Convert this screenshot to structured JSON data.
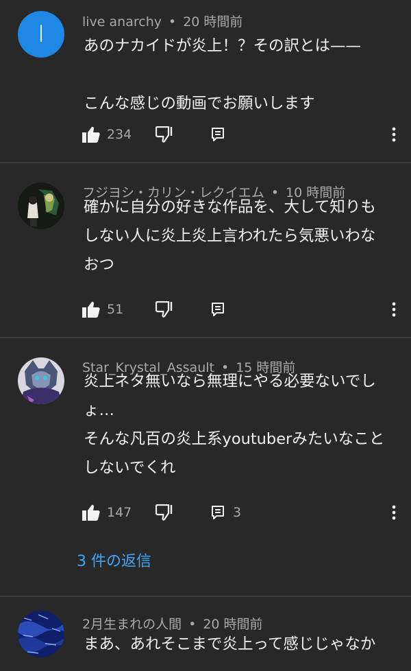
{
  "comments": [
    {
      "author": "live anarchy",
      "time": "20 時間前",
      "avatar_letter": "I",
      "text": "あのナカイドが炎上！？その訳とは——\n\nこんな感じの動画でお願いします",
      "likes": "234",
      "replies": ""
    },
    {
      "author": "フジヨシ・カリン・レクイエム",
      "time": "10 時間前",
      "text": "確かに自分の好きな作品を、大して知りも\nしない人に炎上炎上言われたら気悪いわな\nおつ",
      "likes": "51",
      "replies": ""
    },
    {
      "author": "Star_Krystal_Assault",
      "time": "15 時間前",
      "text": "炎上ネタ無いなら無理にやる必要ないでし\nょ…\nそんな凡百の炎上系youtuberみたいなこと\nしないでくれ",
      "likes": "147",
      "replies": "3",
      "reply_link": "3 件の返信"
    },
    {
      "author": "2月生まれの人間",
      "time": "20 時間前",
      "text": "まあ、あれそこまで炎上って感じじゃなか"
    }
  ],
  "separator": "•",
  "colors": {
    "background": "#282828",
    "text": "#f1f1f1",
    "meta": "#aaaaaa",
    "link": "#3ea6ff",
    "avatar1": "#1e88e5"
  },
  "icons": [
    "thumbs-up-icon",
    "thumbs-down-icon",
    "reply-icon",
    "more-vert-icon"
  ]
}
